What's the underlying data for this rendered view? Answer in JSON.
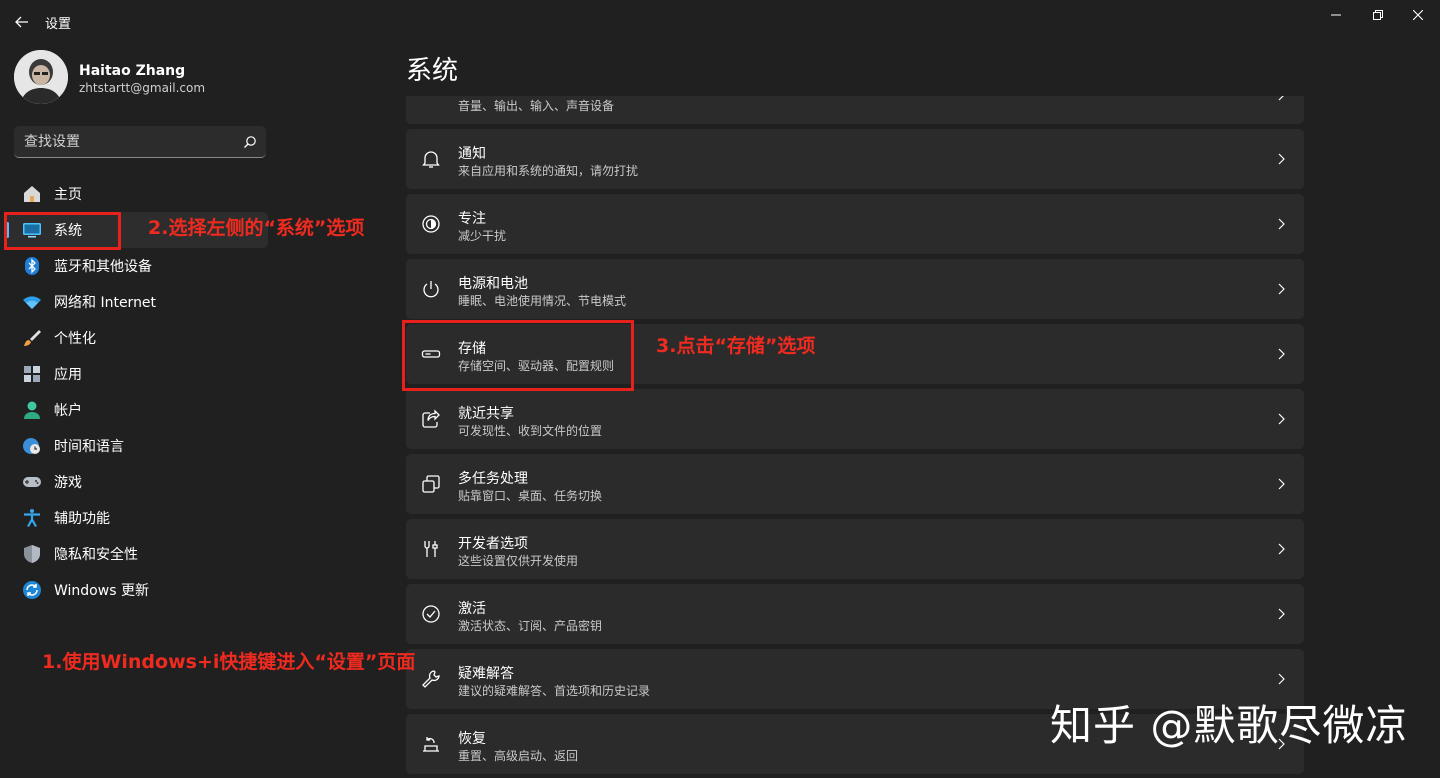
{
  "window": {
    "title": "设置"
  },
  "profile": {
    "name": "Haitao Zhang",
    "email": "zhtstartt@gmail.com"
  },
  "search": {
    "placeholder": "查找设置"
  },
  "nav": {
    "items": [
      {
        "label": "主页",
        "icon": "home-icon"
      },
      {
        "label": "系统",
        "icon": "system-icon",
        "active": true
      },
      {
        "label": "蓝牙和其他设备",
        "icon": "bluetooth-icon"
      },
      {
        "label": "网络和 Internet",
        "icon": "wifi-icon"
      },
      {
        "label": "个性化",
        "icon": "brush-icon"
      },
      {
        "label": "应用",
        "icon": "apps-icon"
      },
      {
        "label": "帐户",
        "icon": "account-icon"
      },
      {
        "label": "时间和语言",
        "icon": "globe-clock-icon"
      },
      {
        "label": "游戏",
        "icon": "gamepad-icon"
      },
      {
        "label": "辅助功能",
        "icon": "accessibility-icon"
      },
      {
        "label": "隐私和安全性",
        "icon": "shield-icon"
      },
      {
        "label": "Windows 更新",
        "icon": "update-icon"
      }
    ]
  },
  "main": {
    "title": "系统",
    "cards": [
      {
        "title": "",
        "subtitle": "音量、输出、输入、声音设备",
        "icon": "speaker-icon"
      },
      {
        "title": "通知",
        "subtitle": "来自应用和系统的通知，请勿打扰",
        "icon": "bell-icon"
      },
      {
        "title": "专注",
        "subtitle": "减少干扰",
        "icon": "focus-icon"
      },
      {
        "title": "电源和电池",
        "subtitle": "睡眠、电池使用情况、节电模式",
        "icon": "power-icon"
      },
      {
        "title": "存储",
        "subtitle": "存储空间、驱动器、配置规则",
        "icon": "storage-icon"
      },
      {
        "title": "就近共享",
        "subtitle": "可发现性、收到文件的位置",
        "icon": "share-icon"
      },
      {
        "title": "多任务处理",
        "subtitle": "贴靠窗口、桌面、任务切换",
        "icon": "multitask-icon"
      },
      {
        "title": "开发者选项",
        "subtitle": "这些设置仅供开发使用",
        "icon": "developer-icon"
      },
      {
        "title": "激活",
        "subtitle": "激活状态、订阅、产品密钥",
        "icon": "check-circle-icon"
      },
      {
        "title": "疑难解答",
        "subtitle": "建议的疑难解答、首选项和历史记录",
        "icon": "wrench-icon"
      },
      {
        "title": "恢复",
        "subtitle": "重置、高级启动、返回",
        "icon": "recovery-icon"
      }
    ]
  },
  "annotations": {
    "step1": "1.使用Windows+i快捷键进入“设置”页面",
    "step2": "2.选择左侧的“系统”选项",
    "step3": "3.点击“存储”选项"
  },
  "watermark": "知乎 @默歌尽微凉",
  "colors": {
    "background": "#202020",
    "card": "#2b2b2b",
    "accent": "#4cc2ff",
    "annotation": "#e8211d"
  }
}
